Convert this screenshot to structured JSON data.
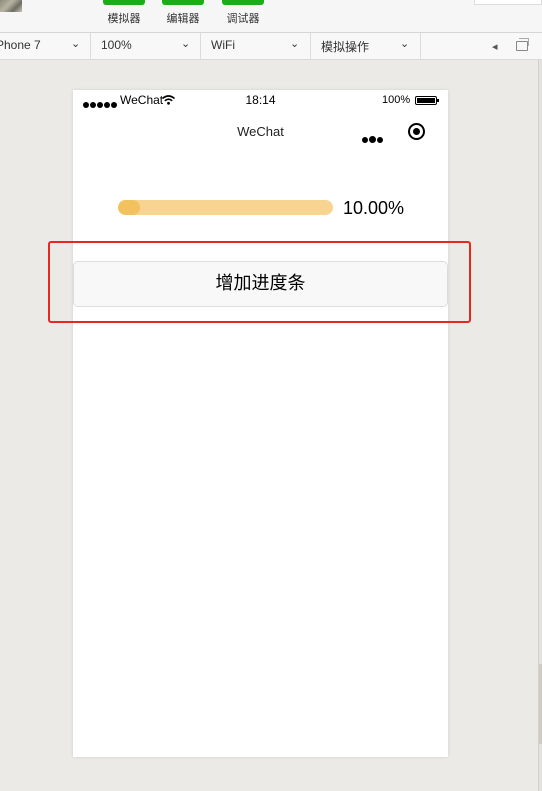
{
  "toolbar": {
    "tools": [
      {
        "label": "模拟器"
      },
      {
        "label": "编辑器"
      },
      {
        "label": "调试器"
      }
    ],
    "accent": "#1aad19"
  },
  "devicebar": {
    "device": "Phone 7",
    "zoom": "100%",
    "network": "WiFi",
    "action": "模拟操作"
  },
  "phone": {
    "status": {
      "carrier": "WeChat",
      "time": "18:14",
      "battery": "100%"
    },
    "nav": {
      "title": "WeChat"
    },
    "progress": {
      "percent": 10,
      "label": "10.00%",
      "track_color": "#f7d590",
      "fill_color": "#f2c25f"
    },
    "button": {
      "label": "增加进度条"
    }
  },
  "highlight_color": "#e8281e"
}
